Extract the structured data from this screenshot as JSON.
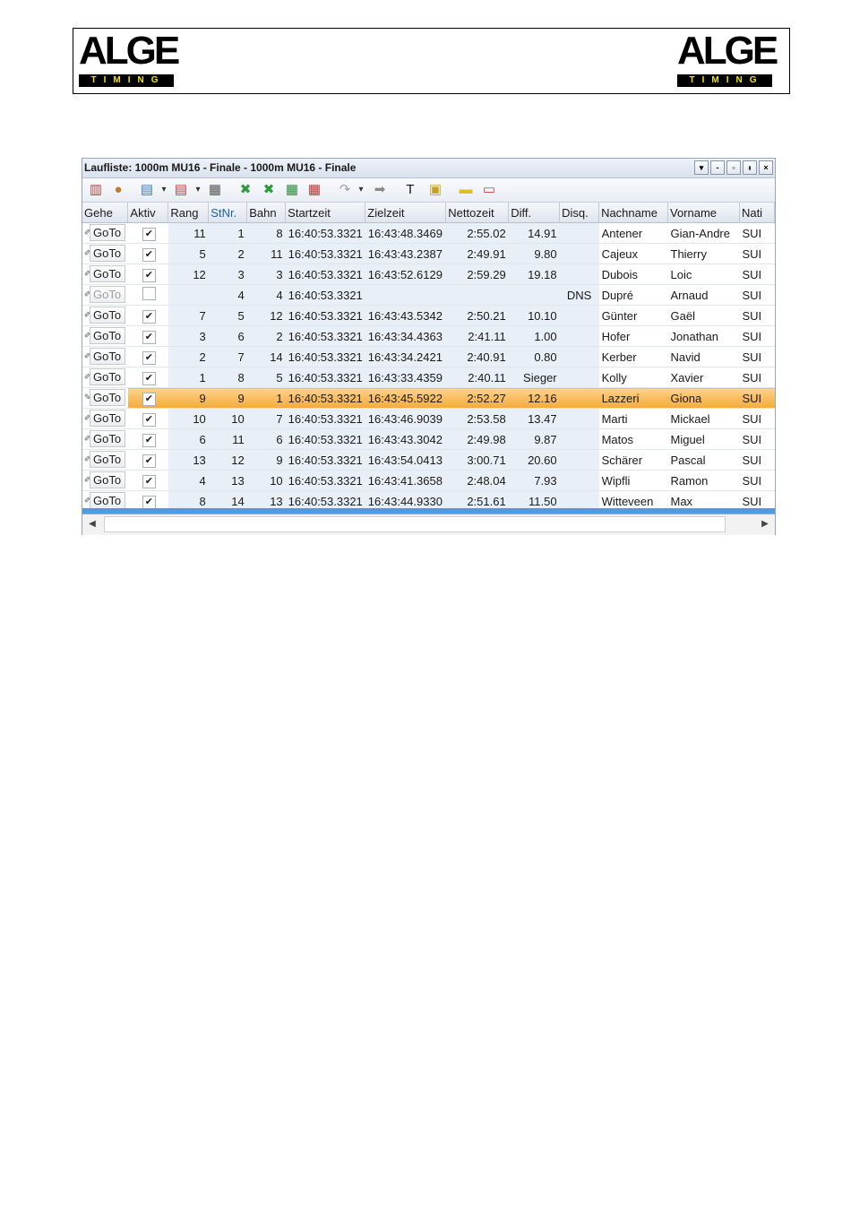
{
  "logo": {
    "word": "ALGE",
    "sub": "TIMING",
    "sub_color": "#f2e600"
  },
  "window": {
    "title": "Laufliste: 1000m MU16 - Finale - 1000m MU16 - Finale",
    "buttons": [
      "▾",
      "-",
      "▫",
      "ᵻ",
      "×"
    ]
  },
  "toolbar": {
    "icons": [
      "columns-icon",
      "users-icon",
      "add-list-icon",
      "dropdown-icon",
      "delete-list-icon",
      "dropdown-icon",
      "settings-icon",
      "excel-green-icon",
      "excel-green-icon",
      "sheet-import-icon",
      "sheet-export-icon",
      "redo-icon",
      "dropdown-icon",
      "arrow-right-icon",
      "transponder-icon",
      "lock-icon",
      "logo-icon",
      "video-wall-icon"
    ]
  },
  "columns": [
    "Gehe",
    "Aktiv",
    "Rang",
    "StNr.",
    "Bahn",
    "Startzeit",
    "Zielzeit",
    "Nettozeit",
    "Diff.",
    "Disq.",
    "Nachname",
    "Vorname",
    "Nati"
  ],
  "goto_label": "GoTo",
  "rows": [
    {
      "aktiv": true,
      "rang": "11",
      "stnr": "1",
      "bahn": "8",
      "start": "16:40:53.3321",
      "ziel": "16:43:48.3469",
      "netto": "2:55.02",
      "diff": "14.91",
      "disq": "",
      "nach": "Antener",
      "vor": "Gian-Andre",
      "nati": "SUI"
    },
    {
      "aktiv": true,
      "rang": "5",
      "stnr": "2",
      "bahn": "11",
      "start": "16:40:53.3321",
      "ziel": "16:43:43.2387",
      "netto": "2:49.91",
      "diff": "9.80",
      "disq": "",
      "nach": "Cajeux",
      "vor": "Thierry",
      "nati": "SUI"
    },
    {
      "aktiv": true,
      "rang": "12",
      "stnr": "3",
      "bahn": "3",
      "start": "16:40:53.3321",
      "ziel": "16:43:52.6129",
      "netto": "2:59.29",
      "diff": "19.18",
      "disq": "",
      "nach": "Dubois",
      "vor": "Loic",
      "nati": "SUI"
    },
    {
      "aktiv": false,
      "rang": "",
      "stnr": "4",
      "bahn": "4",
      "start": "16:40:53.3321",
      "ziel": "",
      "netto": "",
      "diff": "",
      "disq": "DNS",
      "nach": "Dupré",
      "vor": "Arnaud",
      "nati": "SUI"
    },
    {
      "aktiv": true,
      "rang": "7",
      "stnr": "5",
      "bahn": "12",
      "start": "16:40:53.3321",
      "ziel": "16:43:43.5342",
      "netto": "2:50.21",
      "diff": "10.10",
      "disq": "",
      "nach": "Günter",
      "vor": "Gaël",
      "nati": "SUI"
    },
    {
      "aktiv": true,
      "rang": "3",
      "stnr": "6",
      "bahn": "2",
      "start": "16:40:53.3321",
      "ziel": "16:43:34.4363",
      "netto": "2:41.11",
      "diff": "1.00",
      "disq": "",
      "nach": "Hofer",
      "vor": "Jonathan",
      "nati": "SUI"
    },
    {
      "aktiv": true,
      "rang": "2",
      "stnr": "7",
      "bahn": "14",
      "start": "16:40:53.3321",
      "ziel": "16:43:34.2421",
      "netto": "2:40.91",
      "diff": "0.80",
      "disq": "",
      "nach": "Kerber",
      "vor": "Navid",
      "nati": "SUI"
    },
    {
      "aktiv": true,
      "rang": "1",
      "stnr": "8",
      "bahn": "5",
      "start": "16:40:53.3321",
      "ziel": "16:43:33.4359",
      "netto": "2:40.11",
      "diff": "Sieger",
      "disq": "",
      "nach": "Kolly",
      "vor": "Xavier",
      "nati": "SUI"
    },
    {
      "aktiv": true,
      "rang": "9",
      "stnr": "9",
      "bahn": "1",
      "start": "16:40:53.3321",
      "ziel": "16:43:45.5922",
      "netto": "2:52.27",
      "diff": "12.16",
      "disq": "",
      "nach": "Lazzeri",
      "vor": "Giona",
      "nati": "SUI",
      "selected": true
    },
    {
      "aktiv": true,
      "rang": "10",
      "stnr": "10",
      "bahn": "7",
      "start": "16:40:53.3321",
      "ziel": "16:43:46.9039",
      "netto": "2:53.58",
      "diff": "13.47",
      "disq": "",
      "nach": "Marti",
      "vor": "Mickael",
      "nati": "SUI"
    },
    {
      "aktiv": true,
      "rang": "6",
      "stnr": "11",
      "bahn": "6",
      "start": "16:40:53.3321",
      "ziel": "16:43:43.3042",
      "netto": "2:49.98",
      "diff": "9.87",
      "disq": "",
      "nach": "Matos",
      "vor": "Miguel",
      "nati": "SUI"
    },
    {
      "aktiv": true,
      "rang": "13",
      "stnr": "12",
      "bahn": "9",
      "start": "16:40:53.3321",
      "ziel": "16:43:54.0413",
      "netto": "3:00.71",
      "diff": "20.60",
      "disq": "",
      "nach": "Schärer",
      "vor": "Pascal",
      "nati": "SUI"
    },
    {
      "aktiv": true,
      "rang": "4",
      "stnr": "13",
      "bahn": "10",
      "start": "16:40:53.3321",
      "ziel": "16:43:41.3658",
      "netto": "2:48.04",
      "diff": "7.93",
      "disq": "",
      "nach": "Wipfli",
      "vor": "Ramon",
      "nati": "SUI"
    },
    {
      "aktiv": true,
      "rang": "8",
      "stnr": "14",
      "bahn": "13",
      "start": "16:40:53.3321",
      "ziel": "16:43:44.9330",
      "netto": "2:51.61",
      "diff": "11.50",
      "disq": "",
      "nach": "Witteveen",
      "vor": "Max",
      "nati": "SUI"
    }
  ]
}
